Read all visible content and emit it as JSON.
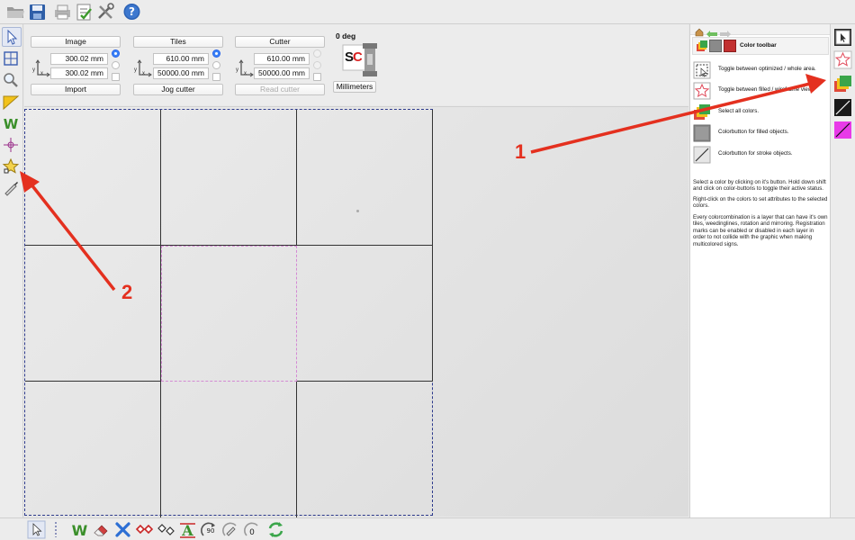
{
  "panel": {
    "image": {
      "title": "Image",
      "width": "300.02 mm",
      "height": "300.02 mm",
      "action": "Import"
    },
    "tiles": {
      "title": "Tiles",
      "width": "610.00 mm",
      "height": "50000.00 mm",
      "action": "Jog cutter"
    },
    "cutter": {
      "title": "Cutter",
      "width": "610.00 mm",
      "height": "50000.00 mm",
      "action": "Read cutter"
    },
    "rotation": "0 deg",
    "logo": "SC",
    "units_button": "Millimeters",
    "axis_x": "x",
    "axis_y": "y"
  },
  "right_panel": {
    "title": "Color toolbar",
    "items": [
      {
        "icon": "select-area-icon",
        "text": "Toggle between optimized / whole area."
      },
      {
        "icon": "star-outline-icon",
        "text": "Toggle between filled / wireframe view."
      },
      {
        "icon": "layers-icon",
        "text": "Select all colors."
      },
      {
        "icon": "fill-color-icon",
        "text": "Colorbutton for filled objects."
      },
      {
        "icon": "stroke-color-icon",
        "text": "Colorbutton for stroke objects."
      }
    ],
    "help": [
      "Select a color by clicking on it's button. Hold down shift and click on color-buttons to toggle their active status.",
      "Right-click on the colors to set attributes to the selected colors.",
      "Every colorcombination is a layer that can have it's own tiles, weedinglines, rotation and mirroring. Registration marks can be enabled or disabled in each layer in order to not collide with the graphic when making multicolored signs."
    ]
  },
  "annotations": {
    "callout_1": "1",
    "callout_2": "2"
  },
  "colors": {
    "arrow": "#e4301f",
    "accent": "#3b82f6",
    "sheet_border": "#2d3a8c",
    "tile_dash": "#d48ad4"
  }
}
